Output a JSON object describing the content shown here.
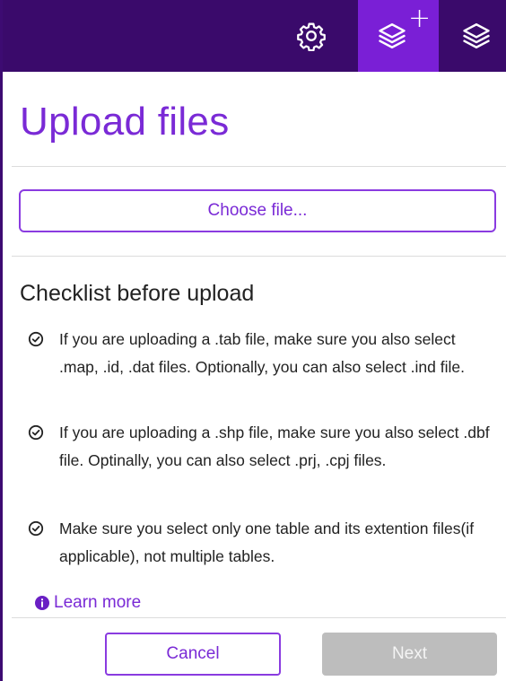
{
  "toolbar": {
    "items": [
      {
        "icon": "gear-icon",
        "active": false
      },
      {
        "icon": "add-layer-icon",
        "badge": "+",
        "active": true
      },
      {
        "icon": "layers-icon",
        "active": false
      }
    ]
  },
  "page": {
    "title": "Upload files"
  },
  "upload": {
    "choose_label": "Choose file..."
  },
  "checklist": {
    "title": "Checklist before upload",
    "items": [
      {
        "text": "If you are uploading a .tab file, make sure you also select .map, .id, .dat files. Optionally, you can also select .ind file."
      },
      {
        "text": "If you are uploading a .shp file, make sure you also select .dbf file. Optinally, you can also select .prj, .cpj files."
      },
      {
        "text": "Make sure you select only one table and its extention files(if applicable), not multiple tables."
      }
    ]
  },
  "learn_more": {
    "label": "Learn more"
  },
  "footer": {
    "cancel_label": "Cancel",
    "next_label": "Next",
    "next_enabled": false
  },
  "colors": {
    "toolbar_bg": "#3a0a6b",
    "active_tab": "#7a1fd6",
    "accent": "#7a2ad6",
    "disabled": "#bdbdbd"
  }
}
